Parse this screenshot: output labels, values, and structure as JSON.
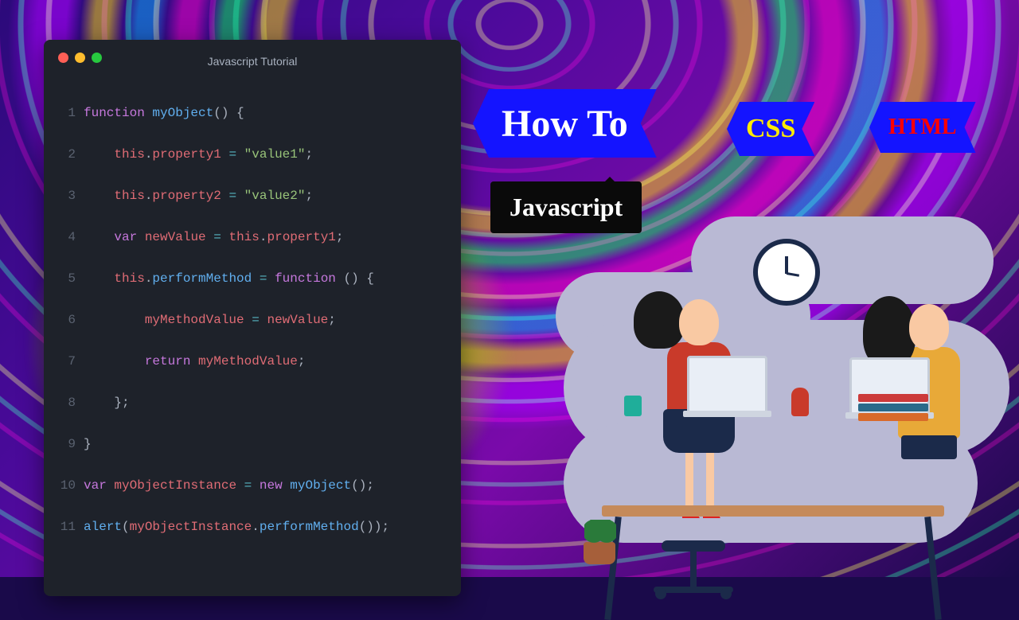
{
  "panel": {
    "title": "Javascript Tutorial",
    "lines": {
      "l1": "function myObject() {",
      "l2": "    this.property1 = \"value1\";",
      "l3": "    this.property2 = \"value2\";",
      "l4": "    var newValue = this.property1;",
      "l5": "    this.performMethod = function () {",
      "l6": "        myMethodValue = newValue;",
      "l7": "        return myMethodValue;",
      "l8": "    };",
      "l9": "}",
      "l10": "var myObjectInstance = new myObject();",
      "l11": "alert(myObjectInstance.performMethod());"
    }
  },
  "badges": {
    "howto": "How To",
    "css": "CSS",
    "html": "HTML",
    "js": "Javascript"
  }
}
